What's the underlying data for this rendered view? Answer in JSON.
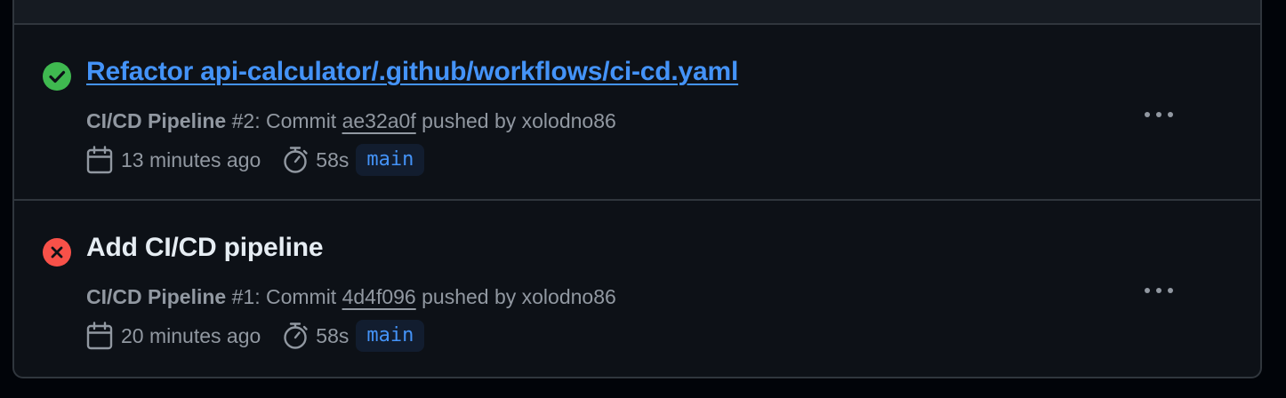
{
  "runs": [
    {
      "status": "success",
      "status_color": "#3fb950",
      "title": "Refactor api-calculator/.github/workflows/ci-cd.yaml",
      "title_is_link": true,
      "workflow": "CI/CD Pipeline",
      "run_number": " #2",
      "commit_prefix": ": Commit ",
      "commit_sha": "ae32a0f",
      "pushed_by": " pushed by xolodno86",
      "time_ago": "13 minutes ago",
      "duration": "58s",
      "branch": "main"
    },
    {
      "status": "failure",
      "status_color": "#f85149",
      "title": "Add CI/CD pipeline",
      "title_is_link": false,
      "workflow": "CI/CD Pipeline",
      "run_number": " #1",
      "commit_prefix": ": Commit ",
      "commit_sha": "4d4f096",
      "pushed_by": " pushed by xolodno86",
      "time_ago": "20 minutes ago",
      "duration": "58s",
      "branch": "main"
    }
  ],
  "icons": {
    "success": "check-circle-icon",
    "failure": "x-circle-icon",
    "calendar": "calendar-icon",
    "stopwatch": "stopwatch-icon",
    "more": "kebab-horizontal-icon"
  }
}
